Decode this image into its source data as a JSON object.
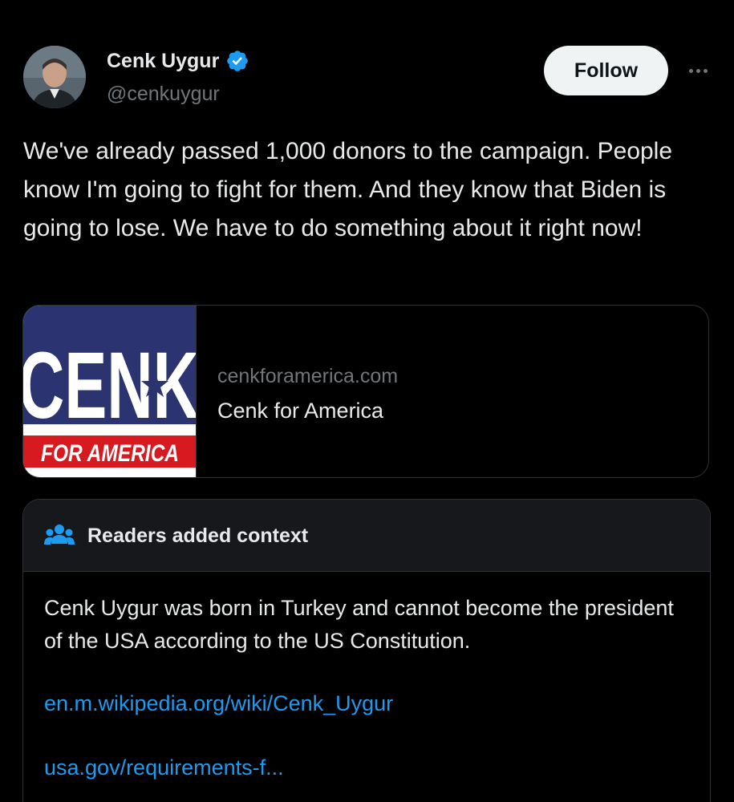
{
  "author": {
    "display_name": "Cenk Uygur",
    "handle": "@cenkuygur",
    "verified": true
  },
  "actions": {
    "follow_label": "Follow",
    "more_icon": "more-horizontal-icon"
  },
  "tweet": {
    "text": "We've already passed 1,000 donors to the campaign. People know I'm going to fight for them. And they know that Biden is going to lose. We have to do something about it right now!"
  },
  "link_card": {
    "domain": "cenkforamerica.com",
    "title": "Cenk for America",
    "image": {
      "logo_text": "CENK",
      "banner_text": "FOR AMERICA"
    }
  },
  "community_note": {
    "header": "Readers added context",
    "icon": "readers-icon",
    "body": "Cenk Uygur was born in Turkey and cannot become the president of the USA according to the US Constitution.",
    "links": [
      "en.m.wikipedia.org/wiki/Cenk_Uygur",
      "usa.gov/requirements-f..."
    ]
  },
  "colors": {
    "background": "#000000",
    "text_primary": "#e7e9ea",
    "text_secondary": "#71767b",
    "accent_blue": "#1d9bf0",
    "border": "#2f3336",
    "logo_navy": "#2b3470",
    "logo_red": "#d71920"
  }
}
